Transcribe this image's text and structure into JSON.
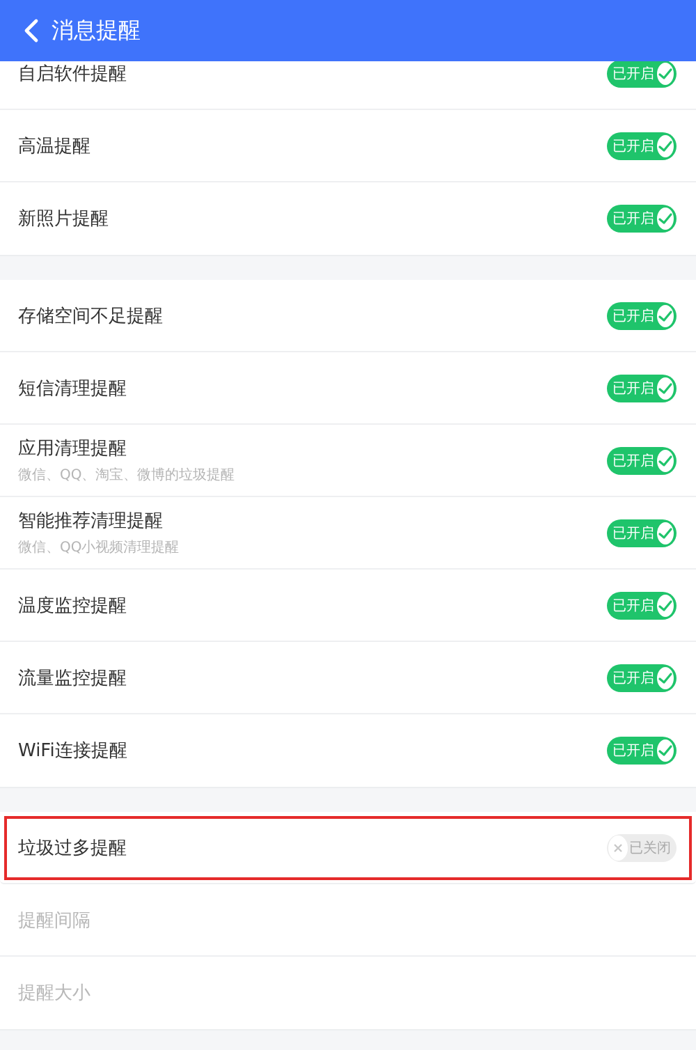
{
  "header": {
    "title": "消息提醒"
  },
  "groups": [
    {
      "rows": [
        {
          "kind": "toggle",
          "label": "自启软件提醒",
          "on": true,
          "toggle_text": "已开启",
          "highlighted": false
        },
        {
          "kind": "toggle",
          "label": "高温提醒",
          "on": true,
          "toggle_text": "已开启",
          "highlighted": false
        },
        {
          "kind": "toggle",
          "label": "新照片提醒",
          "on": true,
          "toggle_text": "已开启",
          "highlighted": false
        }
      ]
    },
    {
      "rows": [
        {
          "kind": "toggle",
          "label": "存储空间不足提醒",
          "on": true,
          "toggle_text": "已开启",
          "highlighted": false
        },
        {
          "kind": "toggle",
          "label": "短信清理提醒",
          "on": true,
          "toggle_text": "已开启",
          "highlighted": false
        },
        {
          "kind": "toggle",
          "label": "应用清理提醒",
          "sublabel": "微信、QQ、淘宝、微博的垃圾提醒",
          "on": true,
          "toggle_text": "已开启",
          "highlighted": false
        },
        {
          "kind": "toggle",
          "label": "智能推荐清理提醒",
          "sublabel": "微信、QQ小视频清理提醒",
          "on": true,
          "toggle_text": "已开启",
          "highlighted": false
        },
        {
          "kind": "toggle",
          "label": "温度监控提醒",
          "on": true,
          "toggle_text": "已开启",
          "highlighted": false
        },
        {
          "kind": "toggle",
          "label": "流量监控提醒",
          "on": true,
          "toggle_text": "已开启",
          "highlighted": false
        },
        {
          "kind": "toggle",
          "label": "WiFi连接提醒",
          "on": true,
          "toggle_text": "已开启",
          "highlighted": false
        }
      ]
    },
    {
      "rows": [
        {
          "kind": "toggle",
          "label": "垃圾过多提醒",
          "on": false,
          "toggle_text": "已关闭",
          "highlighted": true
        },
        {
          "kind": "plain",
          "label": "提醒间隔",
          "disabled": true
        },
        {
          "kind": "plain",
          "label": "提醒大小",
          "disabled": true
        }
      ]
    }
  ]
}
